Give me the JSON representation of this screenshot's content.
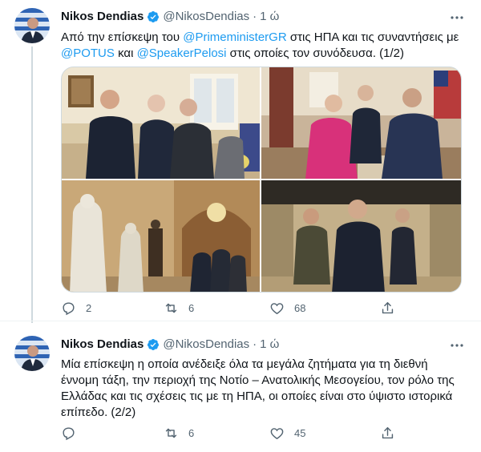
{
  "tweets": [
    {
      "author_name": "Nikos Dendias",
      "handle": "@NikosDendias",
      "separator": "·",
      "time": "1 ώ",
      "text_parts": {
        "p1": "Από την επίσκεψη του ",
        "m1": "@PrimeministerGR",
        "p2": " στις ΗΠΑ και τις συναντήσεις με ",
        "m2": "@POTUS",
        "p3": " και ",
        "m3": "@SpeakerPelosi",
        "p4": "  στις οποίες τον συνόδευσα. (1/2)"
      },
      "media_count": 4,
      "replies": "2",
      "retweets": "6",
      "likes": "68",
      "icons": [
        "verified-badge-icon",
        "more-icon",
        "reply-icon",
        "retweet-icon",
        "like-icon",
        "share-icon"
      ]
    },
    {
      "author_name": "Nikos Dendias",
      "handle": "@NikosDendias",
      "separator": "·",
      "time": "1 ώ",
      "text": "Μία επίσκεψη η οποία ανέδειξε όλα τα μεγάλα ζητήματα για τη διεθνή έννομη τάξη, την περιοχή της Νοτίο – Ανατολικής Μεσογείου, τον ρόλο της Ελλάδας και τις σχέσεις τις με τη ΗΠΑ, οι οποίες είναι στο ύψιστο ιστορικά επίπεδο. (2/2)",
      "replies": "",
      "retweets": "6",
      "likes": "45"
    }
  ],
  "colors": {
    "text": "#0f1419",
    "secondary": "#536471",
    "link": "#1d9bf0",
    "verified": "#1d9bf0",
    "thread_line": "#cfd9de"
  }
}
